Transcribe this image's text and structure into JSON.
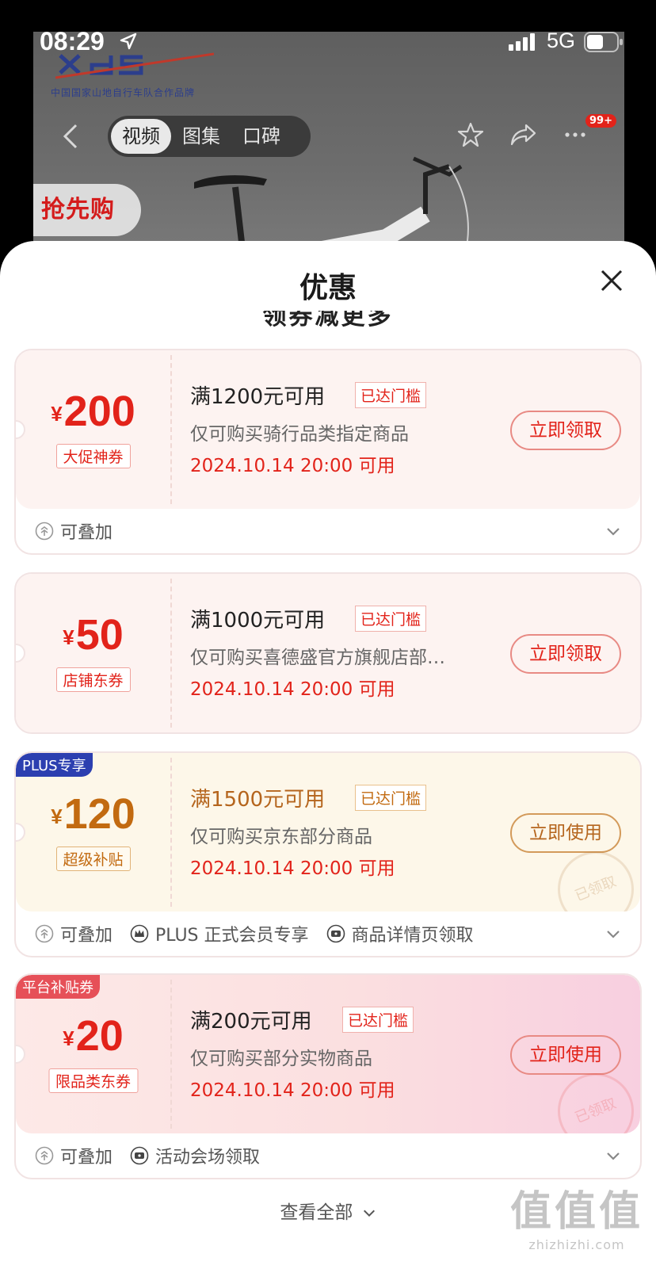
{
  "status_bar": {
    "time": "08:29",
    "network": "5G"
  },
  "background_page": {
    "brand_logo": "XdS",
    "brand_subtitle": "中国国家山地自行车队合作品牌",
    "tabs": [
      {
        "label": "视频",
        "active": true
      },
      {
        "label": "图集",
        "active": false
      },
      {
        "label": "口碑",
        "active": false
      }
    ],
    "message_badge": "99+",
    "promo_tag": "抢先购"
  },
  "sheet": {
    "title": "优惠",
    "partial_heading": "领券减更多",
    "coupons": [
      {
        "currency": "¥",
        "amount": "200",
        "type_label": "大促神券",
        "condition": "满1200元可用",
        "status": "已达门槛",
        "scope": "仅可购买骑行品类指定商品",
        "date": "2024.10.14 20:00 可用",
        "action": "立即领取",
        "footer": [
          "可叠加"
        ]
      },
      {
        "currency": "¥",
        "amount": "50",
        "type_label": "店铺东券",
        "condition": "满1000元可用",
        "status": "已达门槛",
        "scope": "仅可购买喜德盛官方旗舰店部…",
        "date": "2024.10.14 20:00 可用",
        "action": "立即领取"
      },
      {
        "badge": "PLUS专享",
        "currency": "¥",
        "amount": "120",
        "type_label": "超级补贴",
        "condition": "满1500元可用",
        "status": "已达门槛",
        "scope": "仅可购买京东部分商品",
        "date": "2024.10.14 20:00 可用",
        "action": "立即使用",
        "stamp": "已领取",
        "footer": [
          "可叠加",
          "PLUS 正式会员专享",
          "商品详情页领取"
        ]
      },
      {
        "badge": "平台补贴券",
        "currency": "¥",
        "amount": "20",
        "type_label": "限品类东券",
        "condition": "满200元可用",
        "status": "已达门槛",
        "scope": "仅可购买部分实物商品",
        "date": "2024.10.14 20:00 可用",
        "action": "立即使用",
        "stamp": "已领取",
        "footer": [
          "可叠加",
          "活动会场领取"
        ]
      }
    ],
    "view_all": "查看全部"
  },
  "watermark": {
    "big": "值值值",
    "small": "zhizhizhi.com"
  },
  "colors": {
    "accent_red": "#e2231a",
    "gold": "#c26a10",
    "plus_blue": "#2c3fb0"
  }
}
